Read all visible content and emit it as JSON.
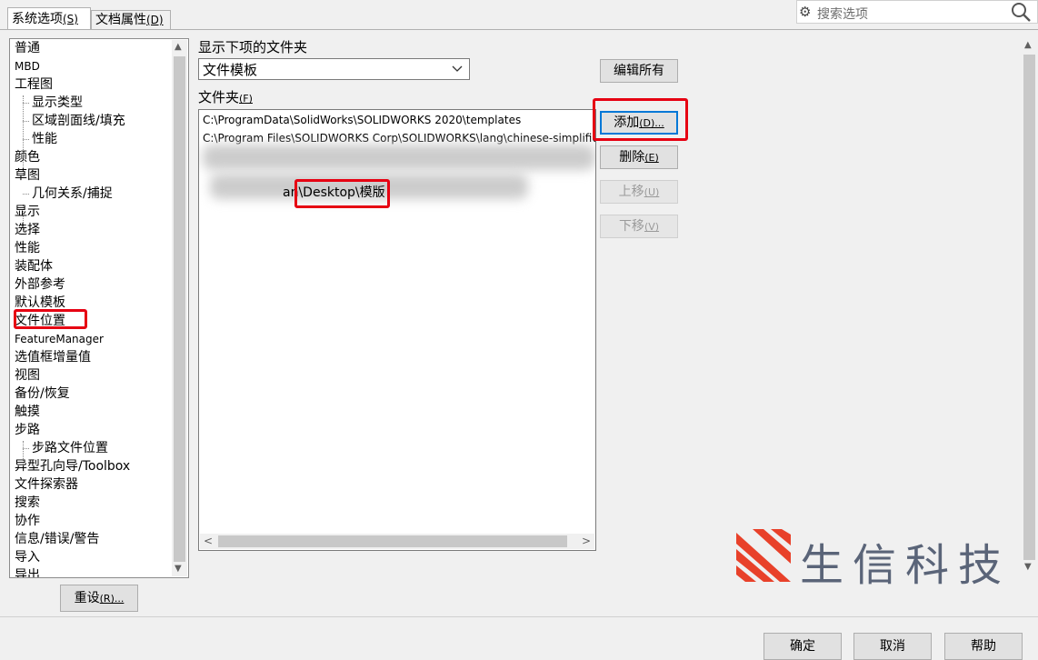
{
  "tabs": {
    "system": {
      "label": "系统选项",
      "key": "(S)"
    },
    "document": {
      "label": "文档属性",
      "key": "(D)"
    }
  },
  "search": {
    "placeholder": "搜索选项",
    "icon": "search-icon",
    "gear_icon": "gear-icon"
  },
  "tree": {
    "items": [
      {
        "label": "普通",
        "level": 0
      },
      {
        "label": "MBD",
        "level": 0
      },
      {
        "label": "工程图",
        "level": 0
      },
      {
        "label": "显示类型",
        "level": 1
      },
      {
        "label": "区域剖面线/填充",
        "level": 1
      },
      {
        "label": "性能",
        "level": 1
      },
      {
        "label": "颜色",
        "level": 0
      },
      {
        "label": "草图",
        "level": 0
      },
      {
        "label": "几何关系/捕捉",
        "level": 1
      },
      {
        "label": "显示",
        "level": 0
      },
      {
        "label": "选择",
        "level": 0
      },
      {
        "label": "性能",
        "level": 0
      },
      {
        "label": "装配体",
        "level": 0
      },
      {
        "label": "外部参考",
        "level": 0
      },
      {
        "label": "默认模板",
        "level": 0
      },
      {
        "label": "文件位置",
        "level": 0
      },
      {
        "label": "FeatureManager",
        "level": 0
      },
      {
        "label": "选值框增量值",
        "level": 0
      },
      {
        "label": "视图",
        "level": 0
      },
      {
        "label": "备份/恢复",
        "level": 0
      },
      {
        "label": "触摸",
        "level": 0
      },
      {
        "label": "步路",
        "level": 0
      },
      {
        "label": "步路文件位置",
        "level": 1
      },
      {
        "label": "异型孔向导/Toolbox",
        "level": 0
      },
      {
        "label": "文件探索器",
        "level": 0
      },
      {
        "label": "搜索",
        "level": 0
      },
      {
        "label": "协作",
        "level": 0
      },
      {
        "label": "信息/错误/警告",
        "level": 0
      },
      {
        "label": "导入",
        "level": 0
      },
      {
        "label": "导出",
        "level": 0
      }
    ]
  },
  "main": {
    "show_folders_label": "显示下项的文件夹",
    "folder_type": "文件模板",
    "folders_label": "文件夹",
    "folders_key": "(F)",
    "folders": [
      "C:\\ProgramData\\SolidWorks\\SOLIDWORKS 2020\\templates",
      "C:\\Program Files\\SOLIDWORKS Corp\\SOLIDWORKS\\lang\\chinese-simplified",
      "an\\Desktop\\模版"
    ]
  },
  "buttons": {
    "edit_all": "编辑所有",
    "add": "添加",
    "add_key": "(D)...",
    "delete": "删除",
    "delete_key": "(E)",
    "move_up": "上移",
    "move_up_key": "(U)",
    "move_down": "下移",
    "move_down_key": "(V)",
    "reset": "重设",
    "reset_key": "(R)...",
    "ok": "确定",
    "cancel": "取消",
    "help": "帮助"
  },
  "watermark": {
    "text": "生信科技"
  },
  "colors": {
    "highlight": "#e60012",
    "logo_red": "#e8412a",
    "logo_text": "#5a6478"
  }
}
